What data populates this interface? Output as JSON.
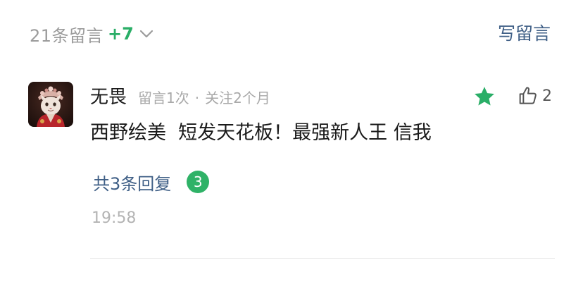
{
  "header": {
    "count_label": "21条留言",
    "delta": "+7",
    "expand_icon": "chevron-down-icon",
    "write_label": "写留言"
  },
  "comment": {
    "username": "无畏",
    "comment_count": "留言1次",
    "separator": "·",
    "follow_duration": "关注2个月",
    "featured_icon": "star-icon",
    "like_icon": "thumbs-up-icon",
    "like_count": "2",
    "text": "西野绘美  短发天花板！最强新人王 信我",
    "replies_label": "共3条回复",
    "replies_badge": "3",
    "time": "19:58"
  },
  "colors": {
    "accent_green": "#2aae67",
    "link_blue": "#3f5f86",
    "muted_gray": "#9b9b9b"
  }
}
